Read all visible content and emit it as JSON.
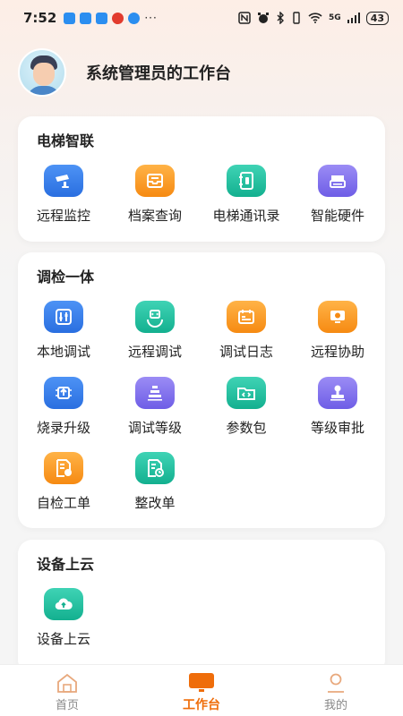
{
  "status_bar": {
    "time": "7:52",
    "battery": "43",
    "network": "5G",
    "more": "···"
  },
  "header": {
    "title": "系统管理员的工作台"
  },
  "sections": [
    {
      "title": "电梯智联",
      "items": [
        {
          "label": "远程监控",
          "icon": "camera-icon",
          "color": "#2a6fe0"
        },
        {
          "label": "档案查询",
          "icon": "archive-tray-icon",
          "color": "#f68a12"
        },
        {
          "label": "电梯通讯录",
          "icon": "address-book-icon",
          "color": "#13b08f"
        },
        {
          "label": "智能硬件",
          "icon": "hardware-box-icon",
          "color": "#6e5de6"
        }
      ]
    },
    {
      "title": "调检一体",
      "items": [
        {
          "label": "本地调试",
          "icon": "sliders-icon",
          "color": "#2a6fe0"
        },
        {
          "label": "远程调试",
          "icon": "remote-sync-icon",
          "color": "#13b08f"
        },
        {
          "label": "调试日志",
          "icon": "log-calendar-icon",
          "color": "#f68a12"
        },
        {
          "label": "远程协助",
          "icon": "help-monitor-icon",
          "color": "#f68a12"
        },
        {
          "label": "烧录升级",
          "icon": "chip-upgrade-icon",
          "color": "#2a6fe0"
        },
        {
          "label": "调试等级",
          "icon": "level-stack-icon",
          "color": "#6e5de6"
        },
        {
          "label": "参数包",
          "icon": "code-folder-icon",
          "color": "#13b08f"
        },
        {
          "label": "等级审批",
          "icon": "stamp-icon",
          "color": "#6e5de6"
        },
        {
          "label": "自检工单",
          "icon": "self-check-doc-icon",
          "color": "#f68a12"
        },
        {
          "label": "整改单",
          "icon": "rectify-doc-icon",
          "color": "#13b08f"
        }
      ]
    },
    {
      "title": "设备上云",
      "items": [
        {
          "label": "设备上云",
          "icon": "cloud-upload-icon",
          "color": "#13b08f"
        }
      ]
    }
  ],
  "tabbar": {
    "tabs": [
      {
        "label": "首页",
        "icon": "home-icon",
        "active": false
      },
      {
        "label": "工作台",
        "icon": "workbench-icon",
        "active": true
      },
      {
        "label": "我的",
        "icon": "profile-icon",
        "active": false
      }
    ],
    "active_color": "#ef6d0a"
  }
}
